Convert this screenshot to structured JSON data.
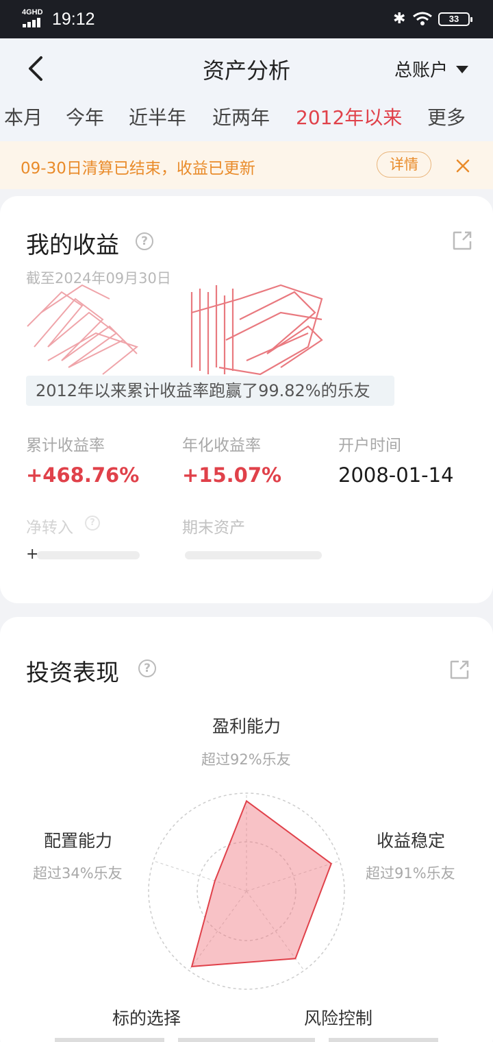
{
  "status": {
    "network": "4GHD",
    "time": "19:12",
    "battery": "33"
  },
  "header": {
    "title": "资产分析",
    "account": "总账户"
  },
  "tabs": [
    "本月",
    "今年",
    "近半年",
    "近两年",
    "2012年以来",
    "更多"
  ],
  "active_tab": "2012年以来",
  "notice": {
    "text": "09-30日清算已结束，收益已更新",
    "button": "详情"
  },
  "earnings": {
    "title": "我的收益",
    "as_of": "截至2024年09月30日",
    "rank_text": "2012年以来累计收益率跑赢了99.82%的乐友",
    "metrics": [
      {
        "label": "累计收益率",
        "value": "+468.76%"
      },
      {
        "label": "年化收益率",
        "value": "+15.07%"
      },
      {
        "label": "开户时间",
        "value": "2008-01-14"
      }
    ],
    "net_in_label": "净转入",
    "end_assets_label": "期末资产",
    "net_in_value_prefix": "+"
  },
  "performance": {
    "title": "投资表现",
    "dimensions": [
      {
        "name": "盈利能力",
        "sub": "超过92%乐友",
        "score": 0.92
      },
      {
        "name": "收益稳定",
        "sub": "超过91%乐友",
        "score": 0.91
      },
      {
        "name": "风险控制",
        "sub": "",
        "score": 0.85
      },
      {
        "name": "标的选择",
        "sub": "",
        "score": 0.95
      },
      {
        "name": "配置能力",
        "sub": "超过34%乐友",
        "score": 0.34
      }
    ]
  },
  "colors": {
    "accent": "#e0414a",
    "notice": "#e98b2a"
  }
}
